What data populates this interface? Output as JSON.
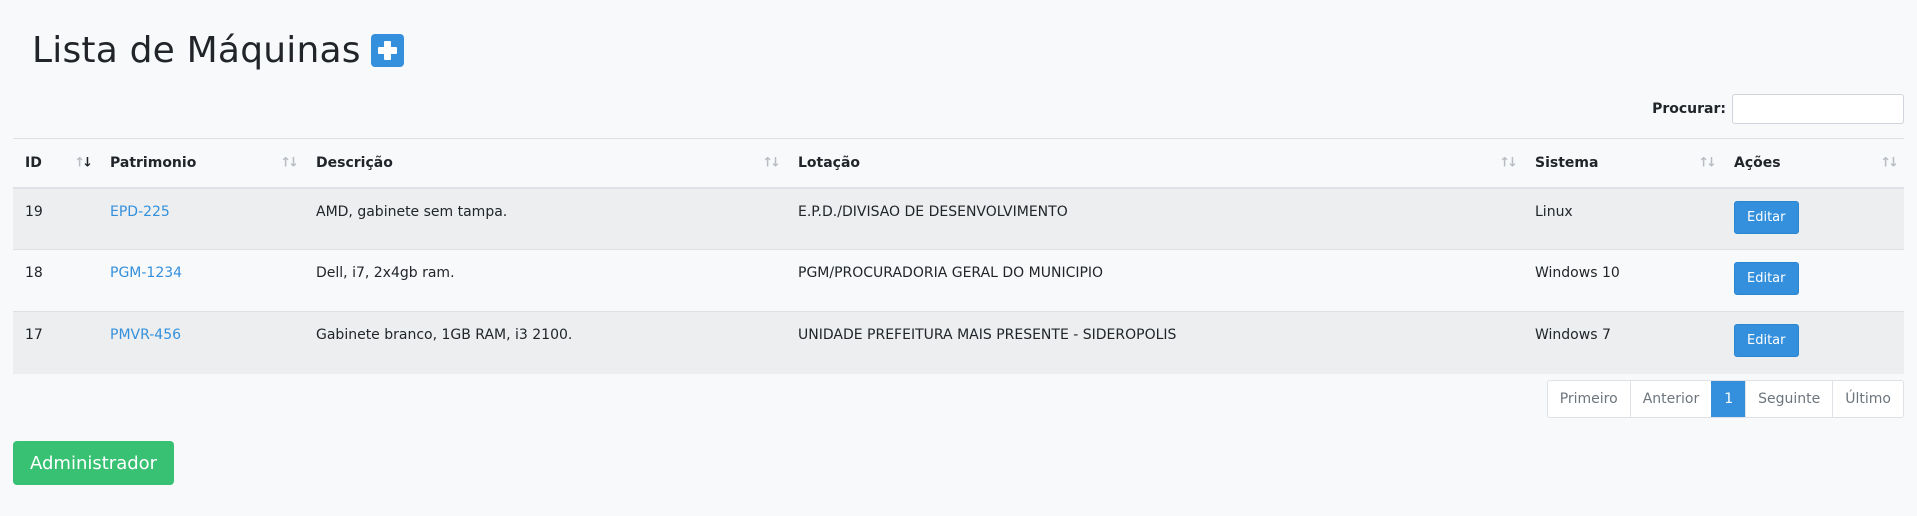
{
  "header": {
    "title": "Lista de Máquinas",
    "add_icon": "plus-square-icon",
    "accent_color": "#3490dc"
  },
  "search": {
    "label": "Procurar:",
    "value": "",
    "placeholder": ""
  },
  "table": {
    "columns": [
      "ID",
      "Patrimonio",
      "Descrição",
      "Lotação",
      "Sistema",
      "Ações"
    ],
    "sorted_column": "ID",
    "rows": [
      {
        "id": "19",
        "patrimonio": "EPD-225",
        "descricao": "AMD, gabinete sem tampa.",
        "lotacao": "E.P.D./DIVISAO DE DESENVOLVIMENTO",
        "sistema": "Linux",
        "acao": "Editar"
      },
      {
        "id": "18",
        "patrimonio": "PGM-1234",
        "descricao": "Dell, i7, 2x4gb ram.",
        "lotacao": "PGM/PROCURADORIA GERAL DO MUNICIPIO",
        "sistema": "Windows 10",
        "acao": "Editar"
      },
      {
        "id": "17",
        "patrimonio": "PMVR-456",
        "descricao": "Gabinete branco, 1GB RAM, i3 2100.",
        "lotacao": "UNIDADE PREFEITURA MAIS PRESENTE - SIDEROPOLIS",
        "sistema": "Windows 7",
        "acao": "Editar"
      }
    ]
  },
  "pagination": {
    "first": "Primeiro",
    "previous": "Anterior",
    "current": "1",
    "next": "Seguinte",
    "last": "Último"
  },
  "footer": {
    "admin_label": "Administrador",
    "admin_color": "#38c172"
  }
}
